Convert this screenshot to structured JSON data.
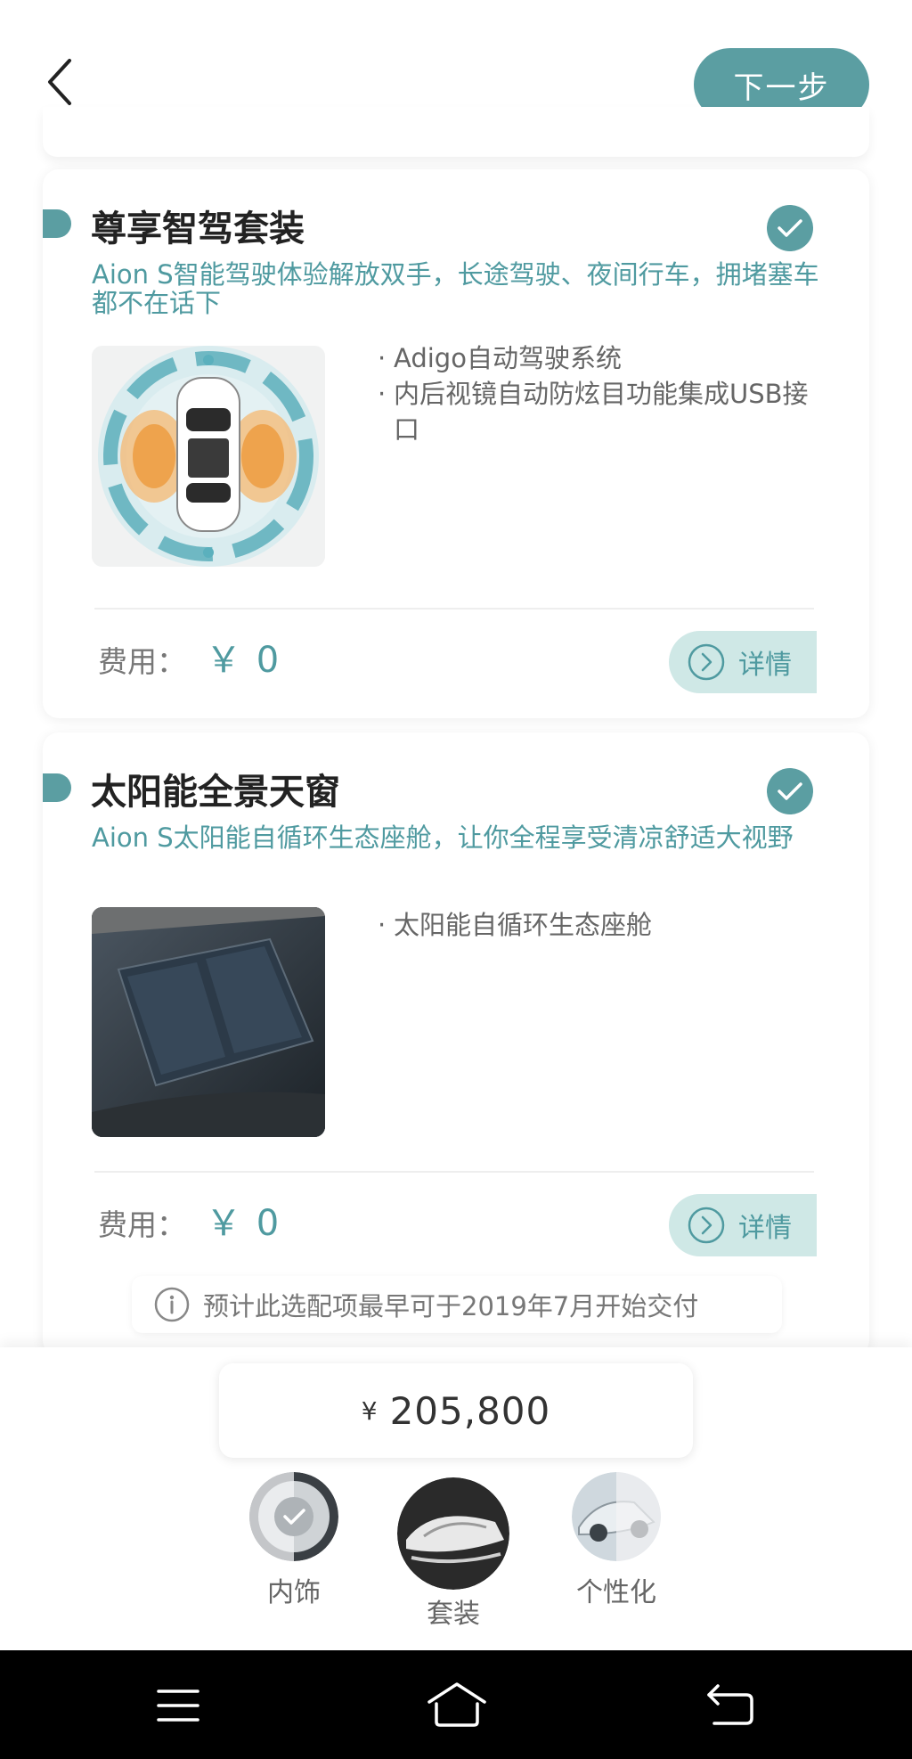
{
  "header": {
    "back_icon": "chevron-left-icon",
    "next_label": "下一步",
    "accent_color": "#5b9ea2"
  },
  "packages": [
    {
      "title": "尊享智驾套装",
      "selected": true,
      "description": "Aion S智能驾驶体验解放双手，长途驾驶、夜间行车，拥堵塞车都不在话下",
      "features": [
        "Adigo自动驾驶系统",
        "内后视镜自动防炫目功能集成USB接口"
      ],
      "fee_label": "费用：",
      "fee_value": "￥ 0",
      "details_label": "详情"
    },
    {
      "title": "太阳能全景天窗",
      "selected": true,
      "description": "Aion S太阳能自循环生态座舱，让你全程享受清凉舒适大视野",
      "features": [
        "太阳能自循环生态座舱"
      ],
      "fee_label": "费用：",
      "fee_value": "￥ 0",
      "details_label": "详情",
      "notice": "预计此选配项最早可于2019年7月开始交付"
    }
  ],
  "summary": {
    "currency": "¥",
    "total_price": "205,800"
  },
  "tabs": [
    {
      "label": "内饰",
      "state": "completed"
    },
    {
      "label": "套装",
      "state": "active"
    },
    {
      "label": "个性化",
      "state": "pending"
    }
  ],
  "system_nav": [
    "menu-icon",
    "home-icon",
    "back-icon"
  ]
}
